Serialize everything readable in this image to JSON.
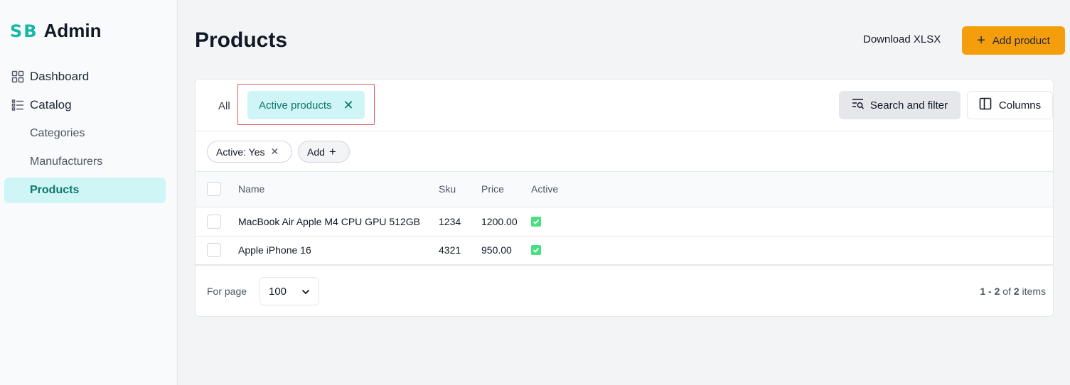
{
  "brand": {
    "mark": "SB",
    "name": "Admin"
  },
  "sidebar": {
    "items": [
      {
        "label": "Dashboard",
        "icon": "grid-icon"
      },
      {
        "label": "Catalog",
        "icon": "list-icon"
      },
      {
        "label": "Categories"
      },
      {
        "label": "Manufacturers"
      },
      {
        "label": "Products",
        "active": true
      }
    ]
  },
  "header": {
    "title": "Products",
    "download_label": "Download XLSX",
    "add_label": "Add product",
    "accent_color": "#f59e0b"
  },
  "tabs": {
    "all_label": "All",
    "active_label": "Active products"
  },
  "toolbar": {
    "search_filter_label": "Search and filter",
    "columns_label": "Columns"
  },
  "filters": {
    "chip_label": "Active: Yes",
    "add_label": "Add"
  },
  "table": {
    "headers": [
      "Name",
      "Sku",
      "Price",
      "Active"
    ],
    "rows": [
      {
        "name": "MacBook Air Apple M4 CPU GPU 512GB",
        "sku": "1234",
        "price": "1200.00",
        "active": true
      },
      {
        "name": "Apple iPhone 16",
        "sku": "4321",
        "price": "950.00",
        "active": true
      }
    ]
  },
  "pagination": {
    "for_page_label": "For page",
    "per_page": "100",
    "range": "1 - 2",
    "of_label": "of",
    "total": "2",
    "items_label": "items"
  }
}
